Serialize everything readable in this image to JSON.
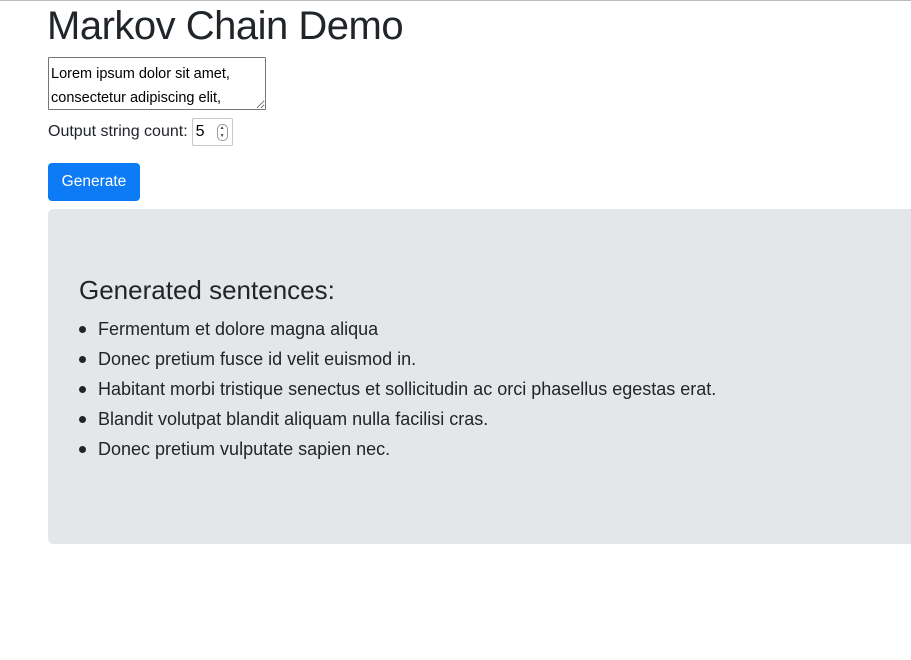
{
  "page": {
    "title": "Markov Chain Demo"
  },
  "source": {
    "text": "Lorem ipsum dolor sit amet, consectetur adipiscing elit,"
  },
  "count": {
    "label": "Output string count:",
    "value": "5"
  },
  "actions": {
    "generate_label": "Generate"
  },
  "results": {
    "heading": "Generated sentences:",
    "sentences": [
      "Fermentum et dolore magna aliqua",
      "Donec pretium fusce id velit euismod in.",
      "Habitant morbi tristique senectus et sollicitudin ac orci phasellus egestas erat.",
      "Blandit volutpat blandit aliquam nulla facilisi cras.",
      "Donec pretium vulputate sapien nec."
    ]
  },
  "colors": {
    "primary": "#0d7bf6",
    "panel_background": "#e4e7ea",
    "text": "#212529"
  }
}
